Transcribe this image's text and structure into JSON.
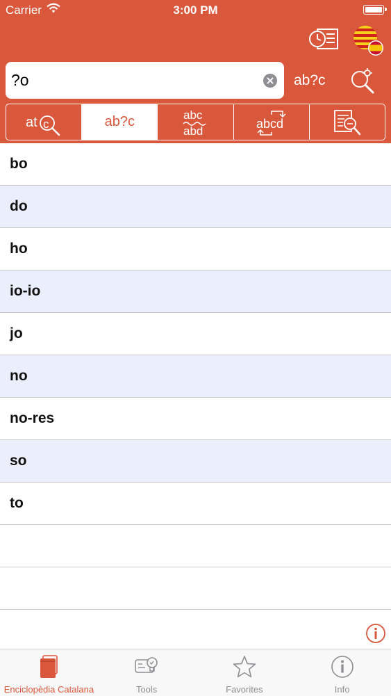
{
  "status_bar": {
    "carrier": "Carrier",
    "time": "3:00 PM"
  },
  "search": {
    "value": "?o",
    "mode_label": "ab?c"
  },
  "segments": [
    {
      "icon": "spelling-search-icon",
      "label": ""
    },
    {
      "icon": "wildcard-search-icon",
      "label": "ab?c"
    },
    {
      "icon": "anagram-icon",
      "label": ""
    },
    {
      "icon": "reverse-search-icon",
      "label": ""
    },
    {
      "icon": "fulltext-search-icon",
      "label": ""
    }
  ],
  "results": [
    "bo",
    "do",
    "ho",
    "io-io",
    "jo",
    "no",
    "no-res",
    "so",
    "to",
    "",
    ""
  ],
  "tabbar": {
    "items": [
      {
        "label": "Enciclopèdia Catalana",
        "icon": "book-icon",
        "active": true
      },
      {
        "label": "Tools",
        "icon": "tools-icon",
        "active": false
      },
      {
        "label": "Favorites",
        "icon": "star-icon",
        "active": false
      },
      {
        "label": "Info",
        "icon": "info-icon",
        "active": false
      }
    ]
  },
  "colors": {
    "accent": "#d9573a",
    "alt_row": "#ebeefb",
    "inactive_tab": "#8e8e93"
  }
}
